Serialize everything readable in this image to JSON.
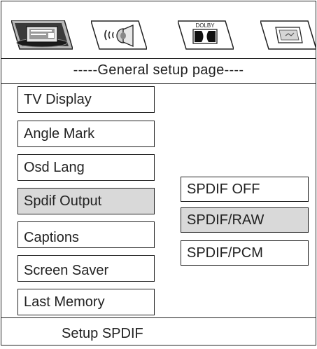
{
  "tabs": [
    {
      "icon": "general-setup-icon",
      "selected": true
    },
    {
      "icon": "audio-speaker-icon",
      "selected": false
    },
    {
      "icon": "dolby-digital-icon",
      "label": "DOLBY",
      "selected": false
    },
    {
      "icon": "preference-icon",
      "selected": false
    }
  ],
  "header": {
    "title": "-----General setup page----"
  },
  "menu": {
    "items": [
      {
        "label": "TV Display",
        "selected": false
      },
      {
        "label": "Angle Mark",
        "selected": false
      },
      {
        "label": "Osd Lang",
        "selected": false
      },
      {
        "label": "Spdif Output",
        "selected": true
      },
      {
        "label": "Captions",
        "selected": false
      },
      {
        "label": "Screen Saver",
        "selected": false
      },
      {
        "label": "Last Memory",
        "selected": false
      }
    ]
  },
  "options": {
    "items": [
      {
        "label": "SPDIF OFF",
        "selected": false
      },
      {
        "label": "SPDIF/RAW",
        "selected": true
      },
      {
        "label": "SPDIF/PCM",
        "selected": false
      }
    ]
  },
  "footer": {
    "text": "Setup SPDIF"
  },
  "colors": {
    "highlight": "#d9d9d9",
    "line": "#222222",
    "background": "#ffffff"
  }
}
